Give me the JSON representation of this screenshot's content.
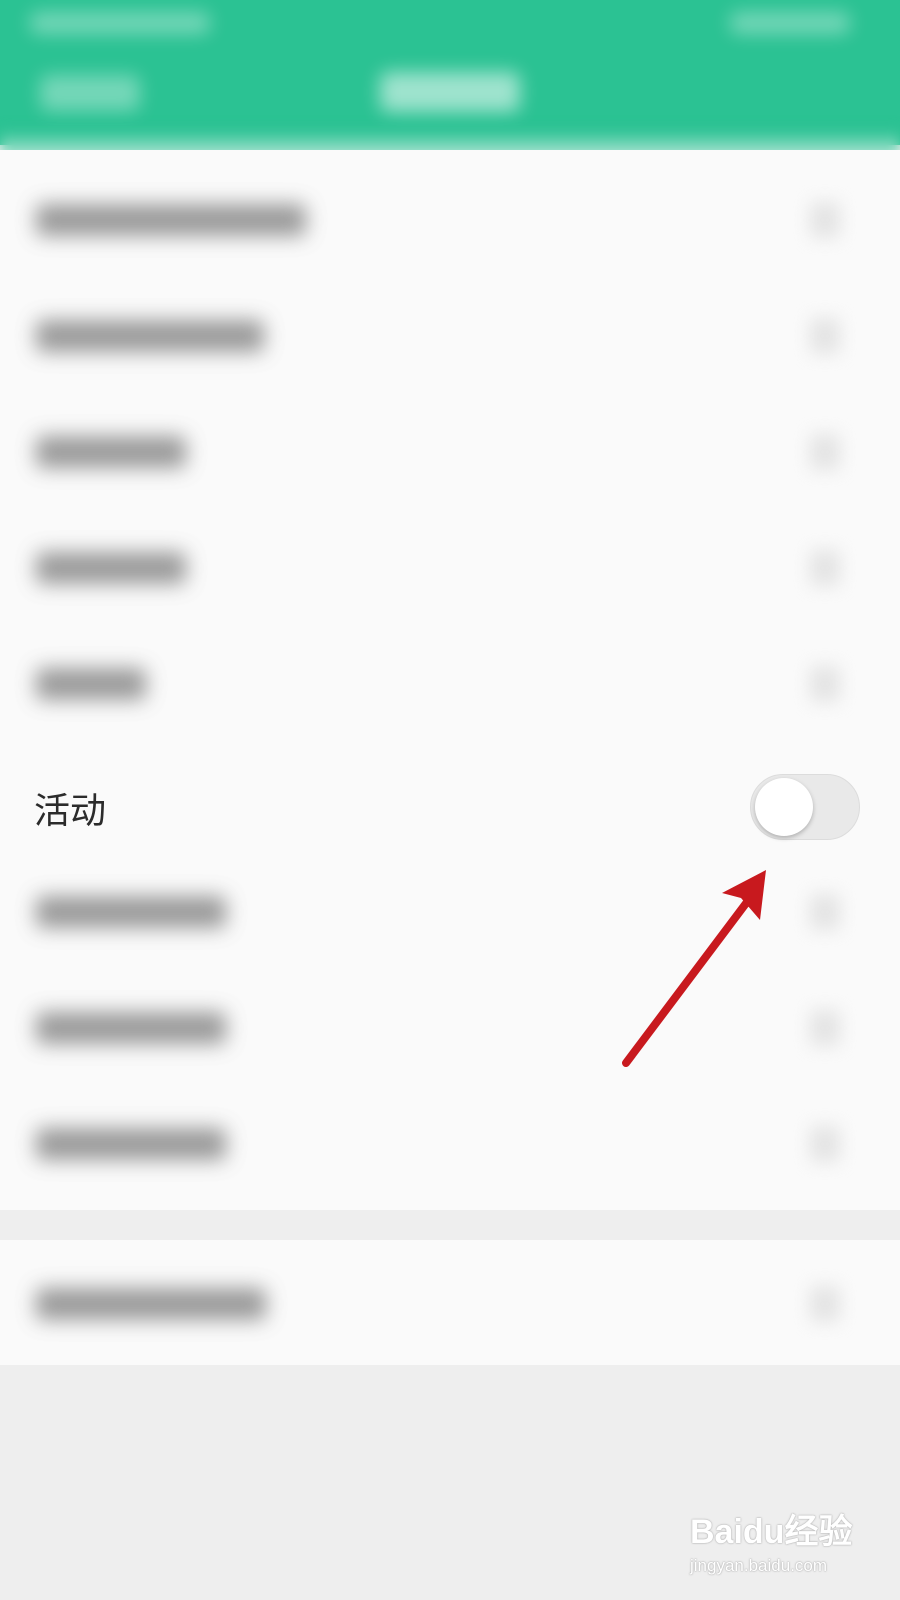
{
  "colors": {
    "header": "#2bc293",
    "arrow": "#c8191e",
    "toggle_track": "#e9e9e9",
    "toggle_knob": "#ffffff",
    "label_text": "#2b2b2b"
  },
  "settings": {
    "activity_row": {
      "label": "活动",
      "toggle_state": "off"
    }
  },
  "annotation": {
    "arrow_icon": "red-arrow-icon"
  },
  "watermark": {
    "brand": "Baidu经验",
    "url": "jingyan.baidu.com"
  }
}
